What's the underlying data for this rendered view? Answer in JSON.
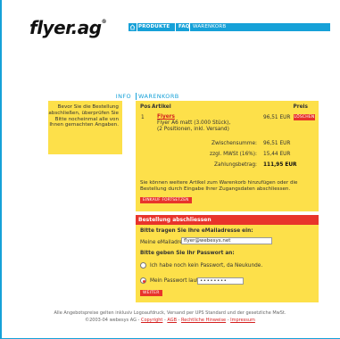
{
  "logo": {
    "brand": "flyer",
    "tld": ".ag",
    "mark": "®"
  },
  "nav": {
    "produkte": "PRODUKTE",
    "faq": "FAQ",
    "warenkorb": "WARENKORB"
  },
  "info": {
    "heading": "INFO",
    "text": "Bevor Sie die Bestellung abschließen, überprüfen Sie Bitte nocheinmal alle von Ihnen gemachten Angaben."
  },
  "cart": {
    "heading": "WARENKORB",
    "col_pos": "Pos",
    "col_article": "Artikel",
    "col_price": "Preis",
    "item": {
      "pos": "1",
      "name": "Flyers",
      "line1": "Flyer A6 matt (3.000 Stück),",
      "line2": "(2 Positionen, inkl. Versand)",
      "price": "96,51 EUR",
      "delete": "LÖSCHEN"
    },
    "subtotal_label": "Zwischensumme:",
    "subtotal": "96,51 EUR",
    "vat_label": "zzgl. MWSt (16%):",
    "vat": "15,44 EUR",
    "total_label": "Zahlungsbetrag:",
    "total": "111,95 EUR",
    "note": "Sie können weitere Artikel zum Warenkorb hinzufügen oder die Bestellung durch Eingabe Ihrer Zugangsdaten abschliessen.",
    "continue": "EINKAUF FORTSETZEN"
  },
  "checkout": {
    "header": "Bestellung abschliessen",
    "email_prompt": "Bitte tragen Sie Ihre eMailadresse ein:",
    "email_label": "Meine eMailadresse:",
    "email_value": "flyer@webesys.net",
    "password_prompt": "Bitte geben Sie Ihr Passwort an:",
    "opt_new": "Ich habe noch kein Passwort, da Neukunde.",
    "opt_existing": "Mein Passwort lautet:",
    "password_value": "••••••••",
    "submit": "WEITER"
  },
  "footer": {
    "line1": "Alle Angebotspreise gelten inklusiv Logoaufdruck, Versand per UPS Standard und der gesetzliche MwSt.",
    "copyright": "©2003-04 webesys AG - ",
    "link_copyright": "Copyright",
    "sep": " - ",
    "link_agb": "AGB",
    "link_legal": "Rechtliche Hinweise",
    "link_impressum": "Impressum"
  }
}
